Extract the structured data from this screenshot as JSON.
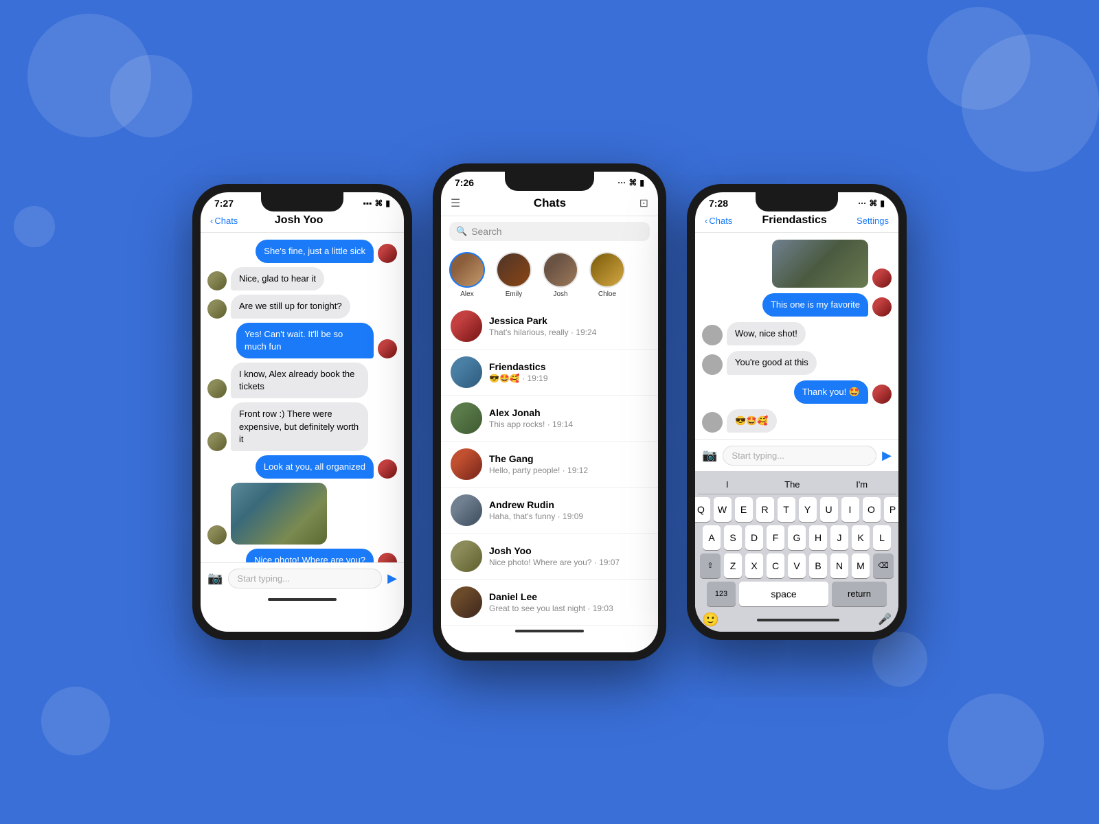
{
  "background": {
    "color": "#3a6fd8"
  },
  "phone_left": {
    "time": "7:27",
    "nav_back": "Chats",
    "nav_title": "Josh Yoo",
    "messages": [
      {
        "type": "sent",
        "text": "She's fine, just a little sick",
        "hasAvatar": true
      },
      {
        "type": "received",
        "text": "Nice, glad to hear it",
        "hasAvatar": true
      },
      {
        "type": "received",
        "text": "Are we still up for tonight?",
        "hasAvatar": true
      },
      {
        "type": "sent",
        "text": "Yes! Can't wait. It'll be so much fun",
        "hasAvatar": true
      },
      {
        "type": "received",
        "text": "I know, Alex already book the tickets",
        "hasAvatar": true
      },
      {
        "type": "received",
        "text": "Front row :) There were expensive, but definitely worth it",
        "hasAvatar": true
      },
      {
        "type": "sent",
        "text": "Look at you, all organized",
        "hasAvatar": true
      },
      {
        "type": "received",
        "hasImage": true,
        "hasAvatar": true
      },
      {
        "type": "sent",
        "text": "Nice photo! Where are you?",
        "hasAvatar": true
      }
    ],
    "input_placeholder": "Start typing...",
    "camera_label": "📷",
    "send_label": "▶"
  },
  "phone_center": {
    "time": "7:26",
    "title": "Chats",
    "search_placeholder": "Search",
    "stories": [
      {
        "name": "Alex",
        "faceClass": "face-alex"
      },
      {
        "name": "Emily",
        "faceClass": "face-emily"
      },
      {
        "name": "Josh",
        "faceClass": "face-josh"
      },
      {
        "name": "Chloe",
        "faceClass": "face-chloe"
      }
    ],
    "chats": [
      {
        "name": "Jessica Park",
        "preview": "That's hilarious, really · 19:24",
        "faceClass": "face-jessica"
      },
      {
        "name": "Friendastics",
        "preview": "😎🤩🥰 · 19:19",
        "faceClass": "face-friendastics"
      },
      {
        "name": "Alex Jonah",
        "preview": "This app rocks! · 19:14",
        "faceClass": "face-alexjonah"
      },
      {
        "name": "The Gang",
        "preview": "Hello, party people! · 19:12",
        "faceClass": "face-thegang"
      },
      {
        "name": "Andrew Rudin",
        "preview": "Haha, that's funny · 19:09",
        "faceClass": "face-andrew"
      },
      {
        "name": "Josh Yoo",
        "preview": "Nice photo! Where are you? · 19:07",
        "faceClass": "face-joshyoo"
      },
      {
        "name": "Daniel Lee",
        "preview": "Great to see you last night · 19:03",
        "faceClass": "face-daniel"
      }
    ]
  },
  "phone_right": {
    "time": "7:28",
    "nav_back": "Chats",
    "nav_title": "Friendastics",
    "nav_settings": "Settings",
    "messages": [
      {
        "type": "sent",
        "text": "This one is my favorite",
        "hasAvatar": true
      },
      {
        "type": "received",
        "text": "Wow, nice shot!",
        "hasAvatar": true
      },
      {
        "type": "received",
        "text": "You're good at this",
        "hasAvatar": true
      },
      {
        "type": "sent",
        "text": "Thank you! 🤩",
        "hasAvatar": true
      },
      {
        "type": "received",
        "text": "😎🤩🥰",
        "hasAvatar": true
      }
    ],
    "input_placeholder": "Start typing...",
    "keyboard": {
      "suggestions": [
        "I",
        "The",
        "I'm"
      ],
      "row1": [
        "Q",
        "W",
        "E",
        "R",
        "T",
        "Y",
        "U",
        "I",
        "O",
        "P"
      ],
      "row2": [
        "A",
        "S",
        "D",
        "F",
        "G",
        "H",
        "J",
        "K",
        "L"
      ],
      "row3": [
        "Z",
        "X",
        "C",
        "V",
        "B",
        "N",
        "M"
      ],
      "bottom_left": "123",
      "space": "space",
      "bottom_right": "return"
    }
  }
}
